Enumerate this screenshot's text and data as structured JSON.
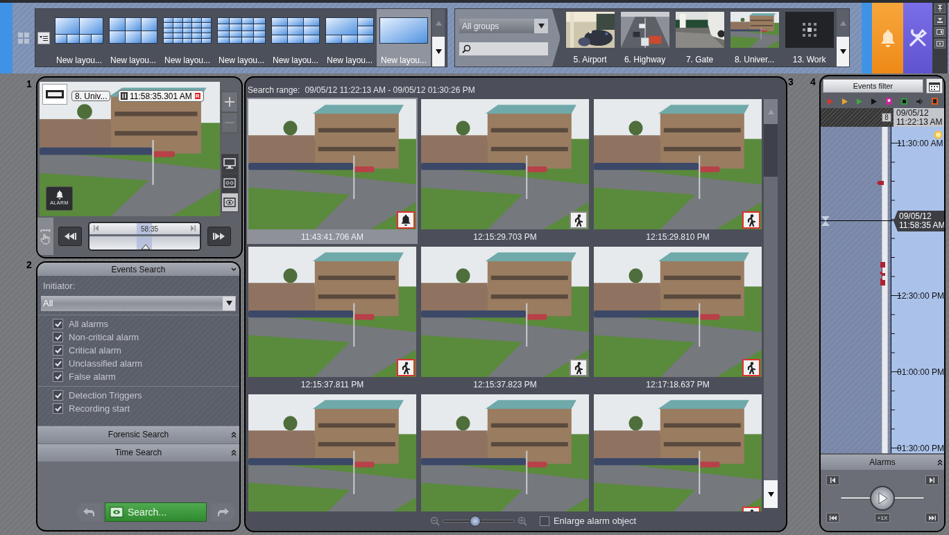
{
  "layouts": [
    {
      "label": "New layou...",
      "kind": "split",
      "selected": false
    },
    {
      "label": "New layou...",
      "kind": "six",
      "selected": false
    },
    {
      "label": "New layou...",
      "kind": "twentyfive",
      "selected": false
    },
    {
      "label": "New layou...",
      "kind": "sixteen",
      "selected": false
    },
    {
      "label": "New layou...",
      "kind": "nine",
      "selected": false
    },
    {
      "label": "New layou...",
      "kind": "corner",
      "selected": false
    },
    {
      "label": "New layou...",
      "kind": "single",
      "selected": true
    }
  ],
  "camera_groups": {
    "group": "All groups"
  },
  "cameras": [
    {
      "label": "5. Airport",
      "kind": "picture"
    },
    {
      "label": "6. Highway",
      "kind": "picture"
    },
    {
      "label": "7. Gate",
      "kind": "picture"
    },
    {
      "label": "8. Univer...",
      "kind": "picture"
    },
    {
      "label": "13. Work",
      "kind": "placeholder"
    }
  ],
  "callouts": [
    "1",
    "2",
    "3",
    "4"
  ],
  "camera_view": {
    "camera": "8. Univ...",
    "time": "11:58:35.301 AM",
    "record_badge": "R",
    "alarm_button": "ALARM",
    "scrubber_time": "58:35",
    "view_modes": [
      {
        "kind": "live",
        "selected": false
      },
      {
        "kind": "archive",
        "selected": false
      },
      {
        "kind": "search",
        "selected": true
      }
    ]
  },
  "events_search": {
    "title": "Events Search",
    "initiator_label": "Initiator:",
    "initiator": "All",
    "groups": [
      {
        "items": [
          {
            "label": "All alarms",
            "checked": true
          },
          {
            "label": "Non-critical alarm",
            "checked": true
          },
          {
            "label": "Critical alarm",
            "checked": true
          },
          {
            "label": "Unclassified alarm",
            "checked": true
          },
          {
            "label": "False alarm",
            "checked": true
          }
        ]
      },
      {
        "items": [
          {
            "label": "Detection Triggers",
            "checked": true
          },
          {
            "label": "Recording start",
            "checked": true
          }
        ]
      }
    ],
    "sections": [
      "Forensic Search",
      "Time Search"
    ],
    "search_button": "Search..."
  },
  "results": {
    "range_label": "Search range:",
    "range": "09/05/12 11:22:13 AM - 09/05/12 01:30:26 PM",
    "tiles": [
      {
        "time": "11:43:41.706 AM",
        "selected": true,
        "kind": "bell",
        "alarm": true
      },
      {
        "time": "12:15:29.703 PM",
        "selected": false,
        "kind": "person",
        "alarm": false
      },
      {
        "time": "12:15:29.810 PM",
        "selected": false,
        "kind": "person",
        "alarm": true
      },
      {
        "time": "12:15:37.811 PM",
        "selected": false,
        "kind": "person",
        "alarm": true
      },
      {
        "time": "12:15:37.823 PM",
        "selected": false,
        "kind": "person",
        "alarm": false
      },
      {
        "time": "12:17:18.637 PM",
        "selected": false,
        "kind": "person",
        "alarm": true
      },
      {
        "selected": false
      },
      {
        "selected": false
      },
      {
        "selected": false,
        "kind": "person",
        "alarm": true
      }
    ],
    "thumbnail_size": {
      "level": 0.45
    },
    "enlarge": {
      "label": "Enlarge alarm object",
      "checked": false
    }
  },
  "timeline": {
    "filter_button": "Events filter",
    "start_date": "09/05/12",
    "start_time": "11:22:13 AM",
    "camera_marker": "8",
    "ticks": [
      "11:30:00 AM",
      "12:30:00 PM",
      "01:00:00 PM",
      "01:30:00 PM"
    ],
    "cursor_date": "09/05/12",
    "cursor_time": "11:58:35 AM",
    "alarms_title": "Alarms",
    "speed_control": {
      "level": 0.5
    },
    "speed": "+1X"
  }
}
